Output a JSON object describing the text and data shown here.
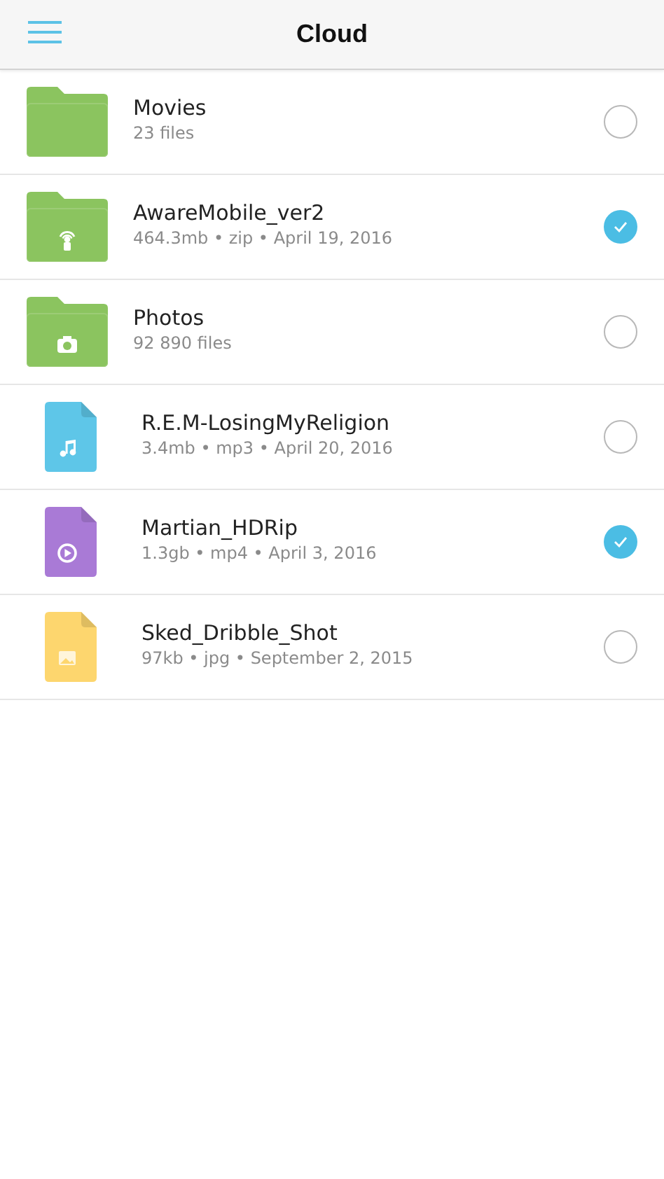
{
  "header": {
    "title": "Cloud"
  },
  "items": [
    {
      "kind": "folder",
      "color": "#8bc45f",
      "name": "Movies",
      "details": "23 files",
      "selected": false
    },
    {
      "kind": "archive",
      "color": "#8bc45f",
      "name": "AwareMobile_ver2",
      "details": "464.3mb • zip • April 19, 2016",
      "selected": true
    },
    {
      "kind": "album",
      "color": "#8bc45f",
      "name": "Photos",
      "details": "92 890 files",
      "selected": false
    },
    {
      "kind": "audio",
      "color": "#5ec6e8",
      "name": "R.E.M-LosingMyReligion",
      "details": "3.4mb • mp3 • April 20, 2016",
      "selected": false
    },
    {
      "kind": "video",
      "color": "#a97ad6",
      "name": "Martian_HDRip",
      "details": "1.3gb • mp4 • April 3, 2016",
      "selected": true
    },
    {
      "kind": "image",
      "color": "#fdd66e",
      "name": "Sked_Dribble_Shot",
      "details": "97kb • jpg • September 2, 2015",
      "selected": false
    }
  ]
}
